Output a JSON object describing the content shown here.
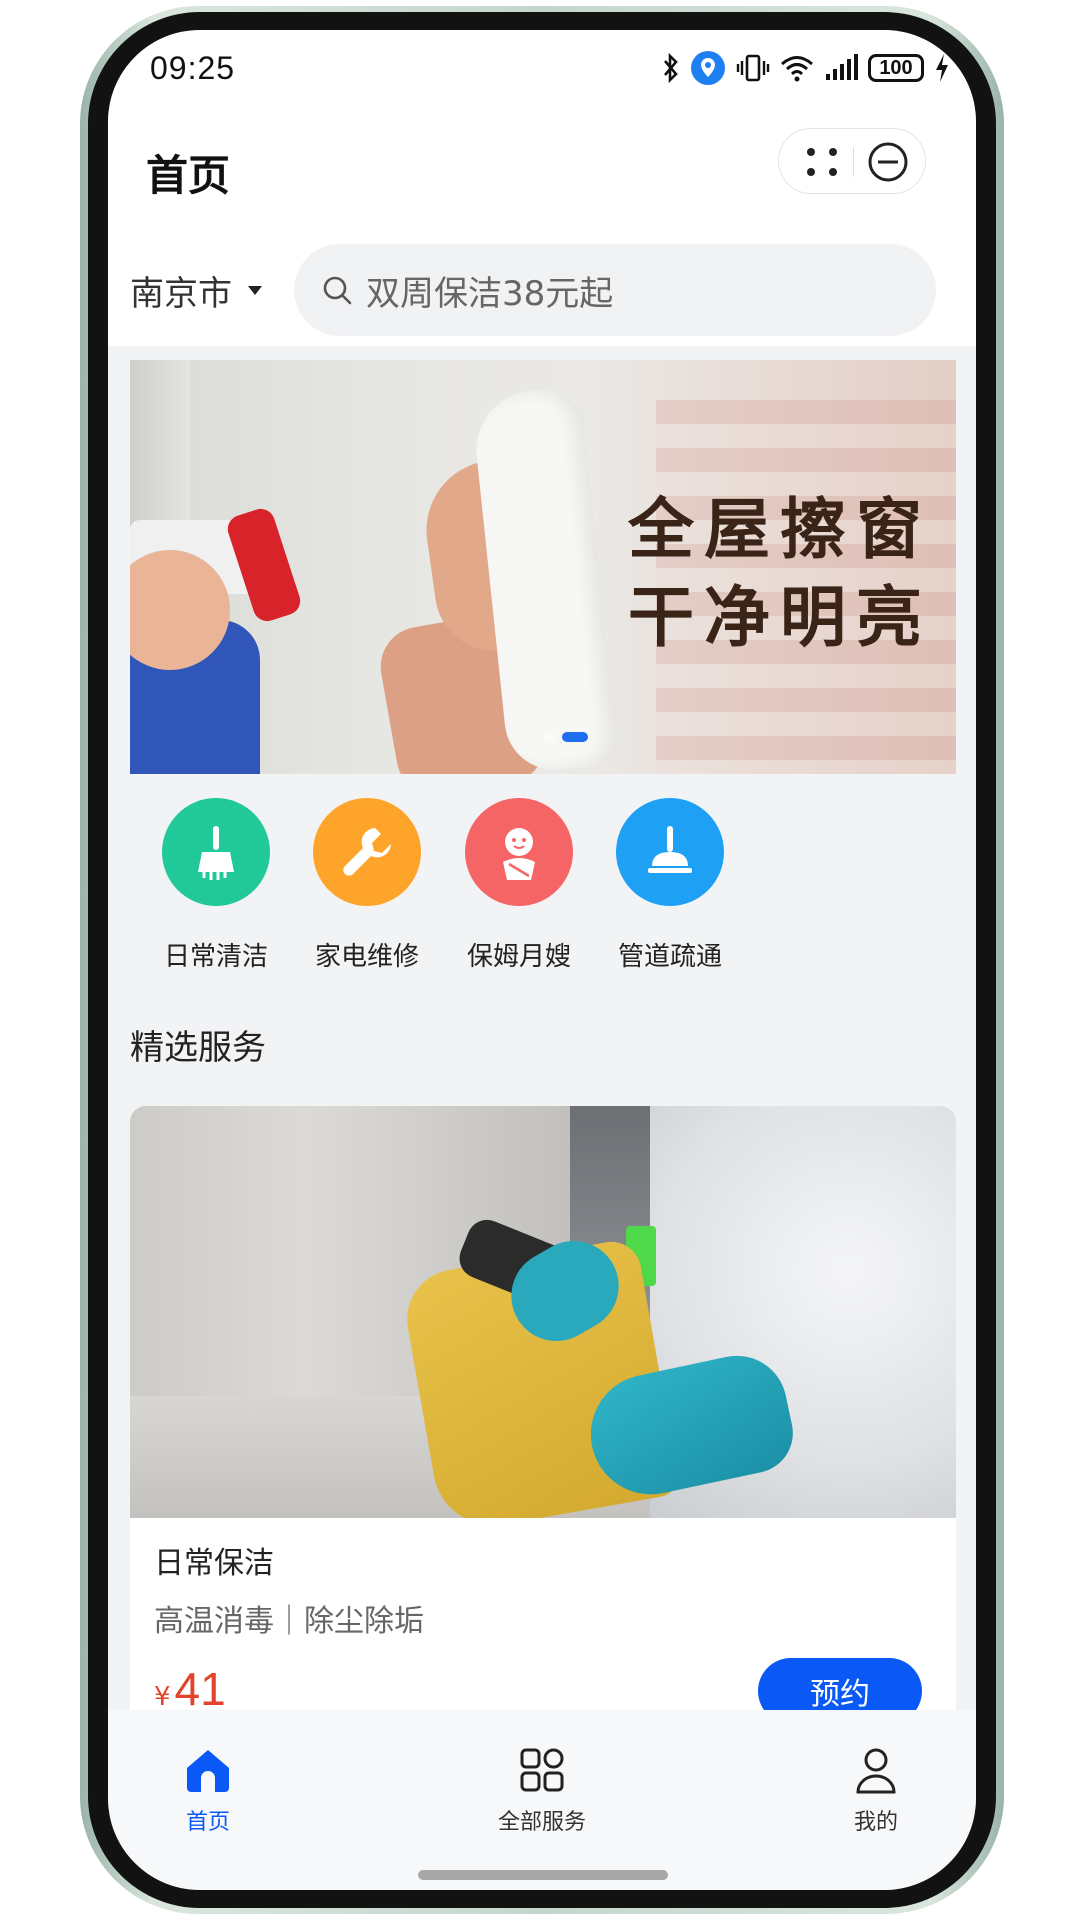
{
  "status_bar": {
    "time": "09:25",
    "battery": "100",
    "icons": [
      "bluetooth-icon",
      "location-icon",
      "vibrate-icon",
      "wifi-icon",
      "signal-icon",
      "battery-icon",
      "charging-icon"
    ]
  },
  "header": {
    "title": "首页",
    "capsule_icons": [
      "more-dots-icon",
      "close-circle-icon"
    ]
  },
  "location": {
    "city": "南京市"
  },
  "search": {
    "placeholder": "双周保洁38元起"
  },
  "banner": {
    "line1": "全屋擦窗",
    "line2": "干净明亮",
    "indicator_count": 2,
    "active_index": 1
  },
  "categories": [
    {
      "label": "日常清洁",
      "icon": "broom-icon",
      "color": "#20c997"
    },
    {
      "label": "家电维修",
      "icon": "wrench-icon",
      "color": "#ffa42b"
    },
    {
      "label": "保姆月嫂",
      "icon": "baby-icon",
      "color": "#f56565"
    },
    {
      "label": "管道疏通",
      "icon": "plunger-icon",
      "color": "#1ea0f5"
    }
  ],
  "section": {
    "title": "精选服务"
  },
  "service_card": {
    "title": "日常保洁",
    "subtitle": "高温消毒｜除尘除垢",
    "currency": "¥",
    "price": "41",
    "button": "预约"
  },
  "tabbar": {
    "items": [
      {
        "label": "首页",
        "icon": "home-icon",
        "active": true
      },
      {
        "label": "全部服务",
        "icon": "grid-icon",
        "active": false
      },
      {
        "label": "我的",
        "icon": "user-icon",
        "active": false
      }
    ]
  },
  "colors": {
    "accent": "#0a59f7",
    "price": "#e2432a"
  }
}
